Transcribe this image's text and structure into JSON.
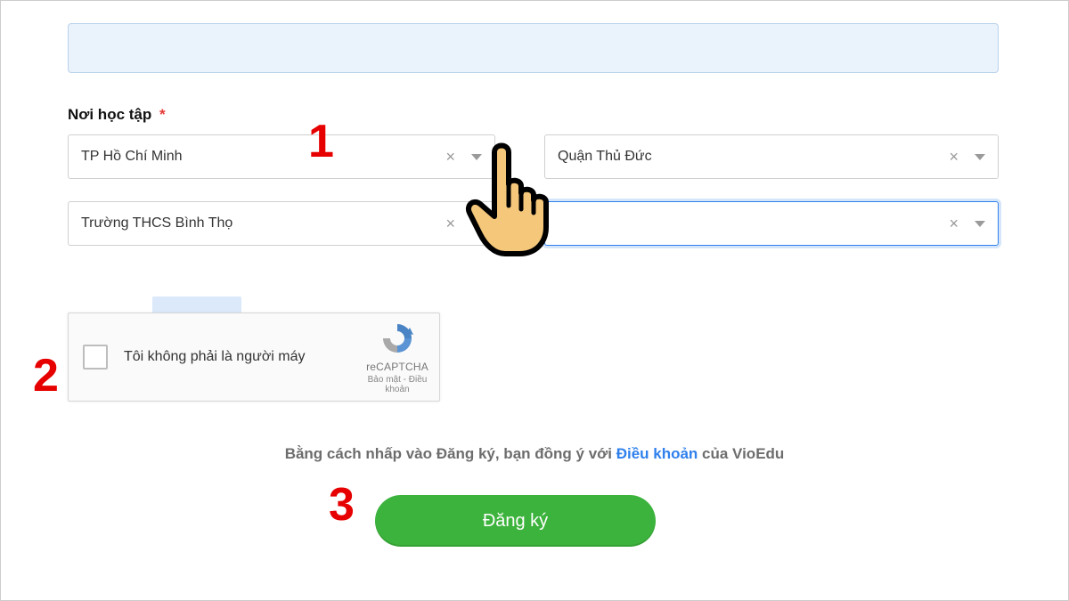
{
  "section": {
    "label": "Nơi học tập",
    "required_mark": "*"
  },
  "selects": {
    "city": {
      "value": "TP Hồ Chí Minh"
    },
    "district": {
      "value": "Quận Thủ Đức"
    },
    "school": {
      "value": "Trường THCS Bình Thọ"
    },
    "class": {
      "value": ""
    }
  },
  "recaptcha": {
    "checkbox_label": "Tôi không phải là người máy",
    "brand": "reCAPTCHA",
    "links": "Bảo mật - Điều khoản"
  },
  "terms": {
    "prefix": "Bằng cách nhấp vào Đăng ký, bạn đồng ý với ",
    "link": "Điều khoản",
    "suffix": " của VioEdu"
  },
  "register": {
    "label": "Đăng ký"
  },
  "annotations": {
    "n1": "1",
    "n2": "2",
    "n3": "3"
  }
}
